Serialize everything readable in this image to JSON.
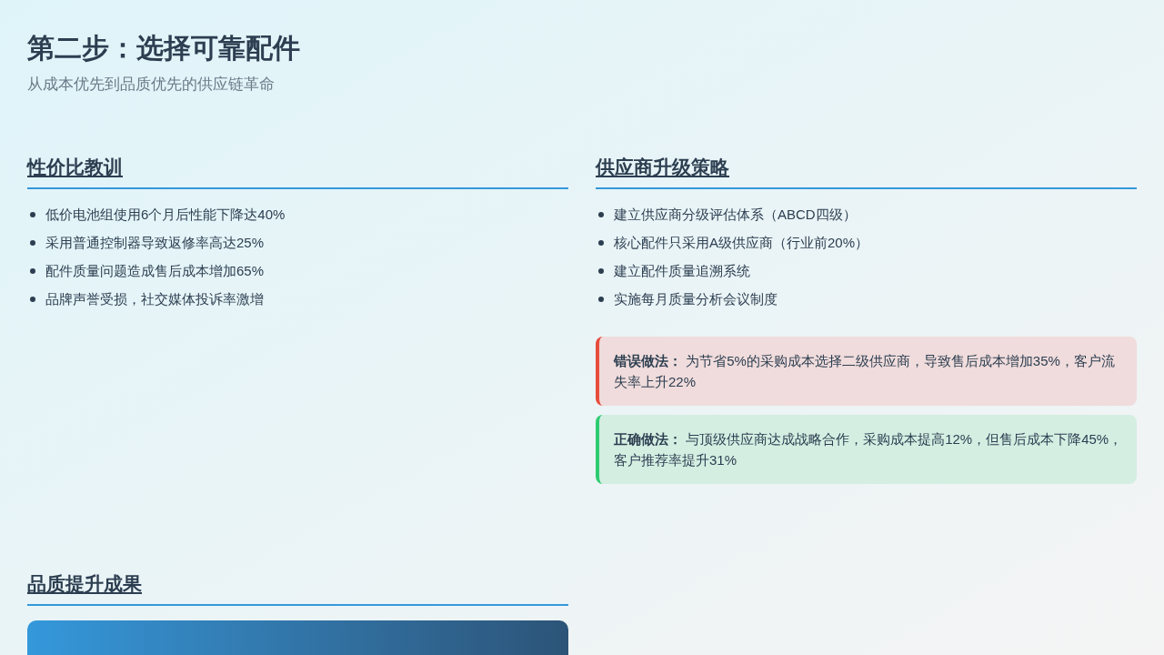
{
  "title": "第二步：选择可靠配件",
  "subtitle": "从成本优先到品质优先的供应链革命",
  "sections": [
    {
      "heading": "性价比教训",
      "items": [
        "低价电池组使用6个月后性能下降达40%",
        "采用普通控制器导致返修率高达25%",
        "配件质量问题造成售后成本增加65%",
        "品牌声誉受损，社交媒体投诉率激增"
      ]
    },
    {
      "heading": "供应商升级策略",
      "items": [
        "建立供应商分级评估体系（ABCD四级）",
        "核心配件只采用A级供应商（行业前20%）",
        "建立配件质量追溯系统",
        "实施每月质量分析会议制度"
      ],
      "callouts": [
        {
          "kind": "wrong",
          "text": "**错误做法：** 为节省5%的采购成本选择二级供应商，导致售后成本增加35%，客户流失率上升22%"
        },
        {
          "kind": "right",
          "text": "**正确做法：** 与顶级供应商达成战略合作，采购成本提高12%，但售后成本下降45%，客户推荐率提升31%"
        }
      ]
    },
    {
      "heading": "品质提升成果",
      "card": {
        "kind": "gradient"
      }
    }
  ]
}
